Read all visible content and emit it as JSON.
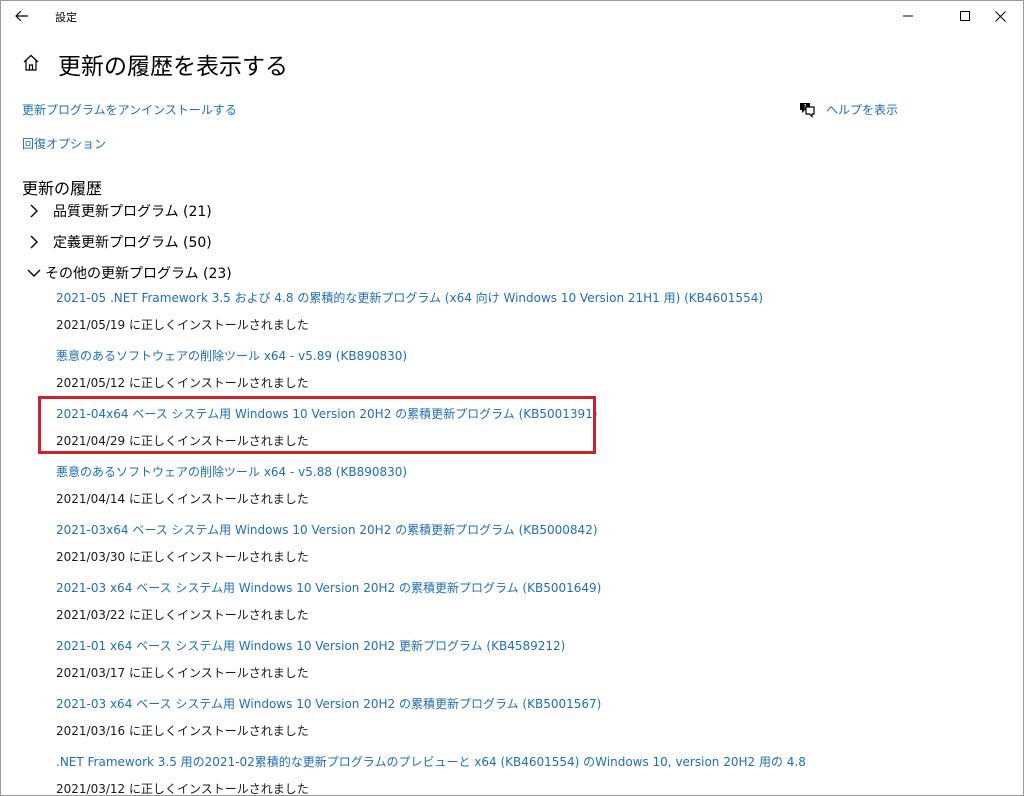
{
  "window": {
    "app_title": "設定",
    "back_icon": "back-arrow-icon",
    "controls": [
      "minimize-icon",
      "maximize-icon",
      "close-icon"
    ]
  },
  "header": {
    "home_icon": "home-icon",
    "title": "更新の履歴を表示する"
  },
  "links": {
    "uninstall": "更新プログラムをアンインストールする",
    "recovery": "回復オプション",
    "help": "ヘルプを表示",
    "help_icon": "help-chat-icon"
  },
  "history": {
    "section_title": "更新の履歴",
    "groups": [
      {
        "label": "品質更新プログラム (21)",
        "expanded": false
      },
      {
        "label": "定義更新プログラム (50)",
        "expanded": false
      },
      {
        "label": "その他の更新プログラム (23)",
        "expanded": true
      }
    ],
    "entries": [
      {
        "title": "2021-05 .NET Framework 3.5 および 4.8 の累積的な更新プログラム (x64 向け Windows 10 Version 21H1 用) (KB4601554)",
        "status": "2021/05/19 に正しくインストールされました"
      },
      {
        "title": "悪意のあるソフトウェアの削除ツール x64 - v5.89 (KB890830)",
        "status": "2021/05/12 に正しくインストールされました"
      },
      {
        "title": "2021-04x64 ベース システム用 Windows 10 Version 20H2 の累積更新プログラム (KB5001391)",
        "status": "2021/04/29 に正しくインストールされました"
      },
      {
        "title": "悪意のあるソフトウェアの削除ツール x64 - v5.88 (KB890830)",
        "status": "2021/04/14 に正しくインストールされました"
      },
      {
        "title": "2021-03x64 ベース システム用 Windows 10 Version 20H2 の累積更新プログラム (KB5000842)",
        "status": "2021/03/30 に正しくインストールされました"
      },
      {
        "title": "2021-03 x64 ベース システム用 Windows 10 Version 20H2 の累積更新プログラム (KB5001649)",
        "status": "2021/03/22 に正しくインストールされました"
      },
      {
        "title": "2021-01 x64 ベース システム用 Windows 10 Version 20H2 更新プログラム (KB4589212)",
        "status": "2021/03/17 に正しくインストールされました"
      },
      {
        "title": "2021-03 x64 ベース システム用 Windows 10 Version 20H2 の累積更新プログラム (KB5001567)",
        "status": "2021/03/16 に正しくインストールされました"
      },
      {
        "title": ".NET Framework 3.5 用の2021-02累積的な更新プログラムのプレビューと x64 (KB4601554) のWindows 10, version 20H2 用の 4.8",
        "status": "2021/03/12 に正しくインストールされました"
      }
    ],
    "highlight_color": "#d0202e",
    "highlighted_entry_index": 2
  },
  "colors": {
    "link": "#1e6fb8",
    "text": "#000000"
  }
}
